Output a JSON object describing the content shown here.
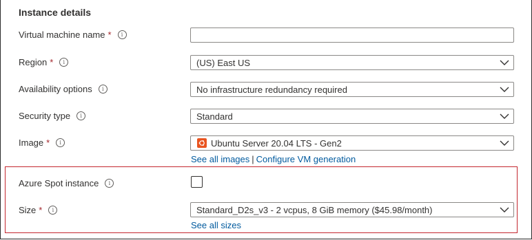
{
  "section": {
    "title": "Instance details"
  },
  "fields": {
    "vm_name": {
      "label": "Virtual machine name",
      "required_mark": "*",
      "value": "",
      "icon": "info-icon"
    },
    "region": {
      "label": "Region",
      "required_mark": "*",
      "value": "(US) East US",
      "icon": "info-icon"
    },
    "availability": {
      "label": "Availability options",
      "value": "No infrastructure redundancy required",
      "icon": "info-icon"
    },
    "security": {
      "label": "Security type",
      "value": "Standard",
      "icon": "info-icon"
    },
    "image": {
      "label": "Image",
      "required_mark": "*",
      "value": "Ubuntu Server 20.04 LTS - Gen2",
      "icon": "ubuntu-logo",
      "links": {
        "see_all": "See all images",
        "separator": "|",
        "configure": "Configure VM generation"
      }
    },
    "spot": {
      "label": "Azure Spot instance",
      "checked": false,
      "icon": "info-icon"
    },
    "size": {
      "label": "Size",
      "required_mark": "*",
      "value": "Standard_D2s_v3 - 2 vcpus, 8 GiB memory ($45.98/month)",
      "links": {
        "see_all": "See all sizes"
      }
    }
  },
  "colors": {
    "required": "#a4262c",
    "link": "#005a9e",
    "highlight_border": "#c4262e",
    "ubuntu": "#e95420"
  },
  "info_glyph": "i"
}
